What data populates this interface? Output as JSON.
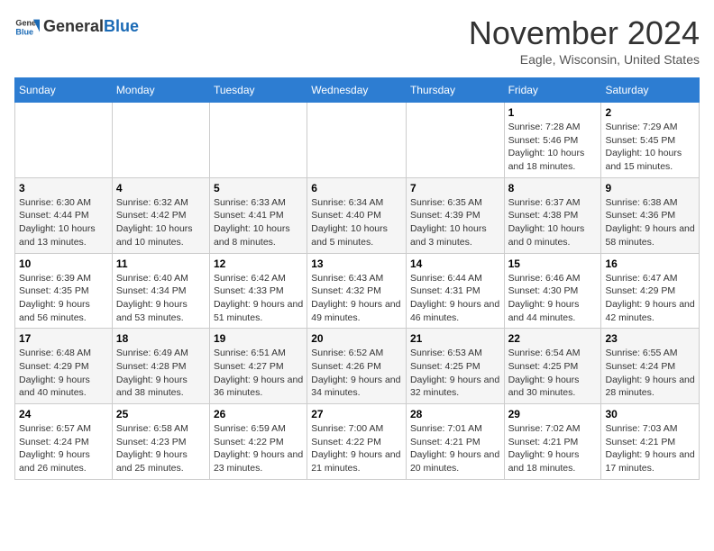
{
  "header": {
    "logo_general": "General",
    "logo_blue": "Blue",
    "month_title": "November 2024",
    "location": "Eagle, Wisconsin, United States"
  },
  "weekdays": [
    "Sunday",
    "Monday",
    "Tuesday",
    "Wednesday",
    "Thursday",
    "Friday",
    "Saturday"
  ],
  "weeks": [
    [
      {
        "day": "",
        "info": ""
      },
      {
        "day": "",
        "info": ""
      },
      {
        "day": "",
        "info": ""
      },
      {
        "day": "",
        "info": ""
      },
      {
        "day": "",
        "info": ""
      },
      {
        "day": "1",
        "info": "Sunrise: 7:28 AM\nSunset: 5:46 PM\nDaylight: 10 hours and 18 minutes."
      },
      {
        "day": "2",
        "info": "Sunrise: 7:29 AM\nSunset: 5:45 PM\nDaylight: 10 hours and 15 minutes."
      }
    ],
    [
      {
        "day": "3",
        "info": "Sunrise: 6:30 AM\nSunset: 4:44 PM\nDaylight: 10 hours and 13 minutes."
      },
      {
        "day": "4",
        "info": "Sunrise: 6:32 AM\nSunset: 4:42 PM\nDaylight: 10 hours and 10 minutes."
      },
      {
        "day": "5",
        "info": "Sunrise: 6:33 AM\nSunset: 4:41 PM\nDaylight: 10 hours and 8 minutes."
      },
      {
        "day": "6",
        "info": "Sunrise: 6:34 AM\nSunset: 4:40 PM\nDaylight: 10 hours and 5 minutes."
      },
      {
        "day": "7",
        "info": "Sunrise: 6:35 AM\nSunset: 4:39 PM\nDaylight: 10 hours and 3 minutes."
      },
      {
        "day": "8",
        "info": "Sunrise: 6:37 AM\nSunset: 4:38 PM\nDaylight: 10 hours and 0 minutes."
      },
      {
        "day": "9",
        "info": "Sunrise: 6:38 AM\nSunset: 4:36 PM\nDaylight: 9 hours and 58 minutes."
      }
    ],
    [
      {
        "day": "10",
        "info": "Sunrise: 6:39 AM\nSunset: 4:35 PM\nDaylight: 9 hours and 56 minutes."
      },
      {
        "day": "11",
        "info": "Sunrise: 6:40 AM\nSunset: 4:34 PM\nDaylight: 9 hours and 53 minutes."
      },
      {
        "day": "12",
        "info": "Sunrise: 6:42 AM\nSunset: 4:33 PM\nDaylight: 9 hours and 51 minutes."
      },
      {
        "day": "13",
        "info": "Sunrise: 6:43 AM\nSunset: 4:32 PM\nDaylight: 9 hours and 49 minutes."
      },
      {
        "day": "14",
        "info": "Sunrise: 6:44 AM\nSunset: 4:31 PM\nDaylight: 9 hours and 46 minutes."
      },
      {
        "day": "15",
        "info": "Sunrise: 6:46 AM\nSunset: 4:30 PM\nDaylight: 9 hours and 44 minutes."
      },
      {
        "day": "16",
        "info": "Sunrise: 6:47 AM\nSunset: 4:29 PM\nDaylight: 9 hours and 42 minutes."
      }
    ],
    [
      {
        "day": "17",
        "info": "Sunrise: 6:48 AM\nSunset: 4:29 PM\nDaylight: 9 hours and 40 minutes."
      },
      {
        "day": "18",
        "info": "Sunrise: 6:49 AM\nSunset: 4:28 PM\nDaylight: 9 hours and 38 minutes."
      },
      {
        "day": "19",
        "info": "Sunrise: 6:51 AM\nSunset: 4:27 PM\nDaylight: 9 hours and 36 minutes."
      },
      {
        "day": "20",
        "info": "Sunrise: 6:52 AM\nSunset: 4:26 PM\nDaylight: 9 hours and 34 minutes."
      },
      {
        "day": "21",
        "info": "Sunrise: 6:53 AM\nSunset: 4:25 PM\nDaylight: 9 hours and 32 minutes."
      },
      {
        "day": "22",
        "info": "Sunrise: 6:54 AM\nSunset: 4:25 PM\nDaylight: 9 hours and 30 minutes."
      },
      {
        "day": "23",
        "info": "Sunrise: 6:55 AM\nSunset: 4:24 PM\nDaylight: 9 hours and 28 minutes."
      }
    ],
    [
      {
        "day": "24",
        "info": "Sunrise: 6:57 AM\nSunset: 4:24 PM\nDaylight: 9 hours and 26 minutes."
      },
      {
        "day": "25",
        "info": "Sunrise: 6:58 AM\nSunset: 4:23 PM\nDaylight: 9 hours and 25 minutes."
      },
      {
        "day": "26",
        "info": "Sunrise: 6:59 AM\nSunset: 4:22 PM\nDaylight: 9 hours and 23 minutes."
      },
      {
        "day": "27",
        "info": "Sunrise: 7:00 AM\nSunset: 4:22 PM\nDaylight: 9 hours and 21 minutes."
      },
      {
        "day": "28",
        "info": "Sunrise: 7:01 AM\nSunset: 4:21 PM\nDaylight: 9 hours and 20 minutes."
      },
      {
        "day": "29",
        "info": "Sunrise: 7:02 AM\nSunset: 4:21 PM\nDaylight: 9 hours and 18 minutes."
      },
      {
        "day": "30",
        "info": "Sunrise: 7:03 AM\nSunset: 4:21 PM\nDaylight: 9 hours and 17 minutes."
      }
    ]
  ]
}
